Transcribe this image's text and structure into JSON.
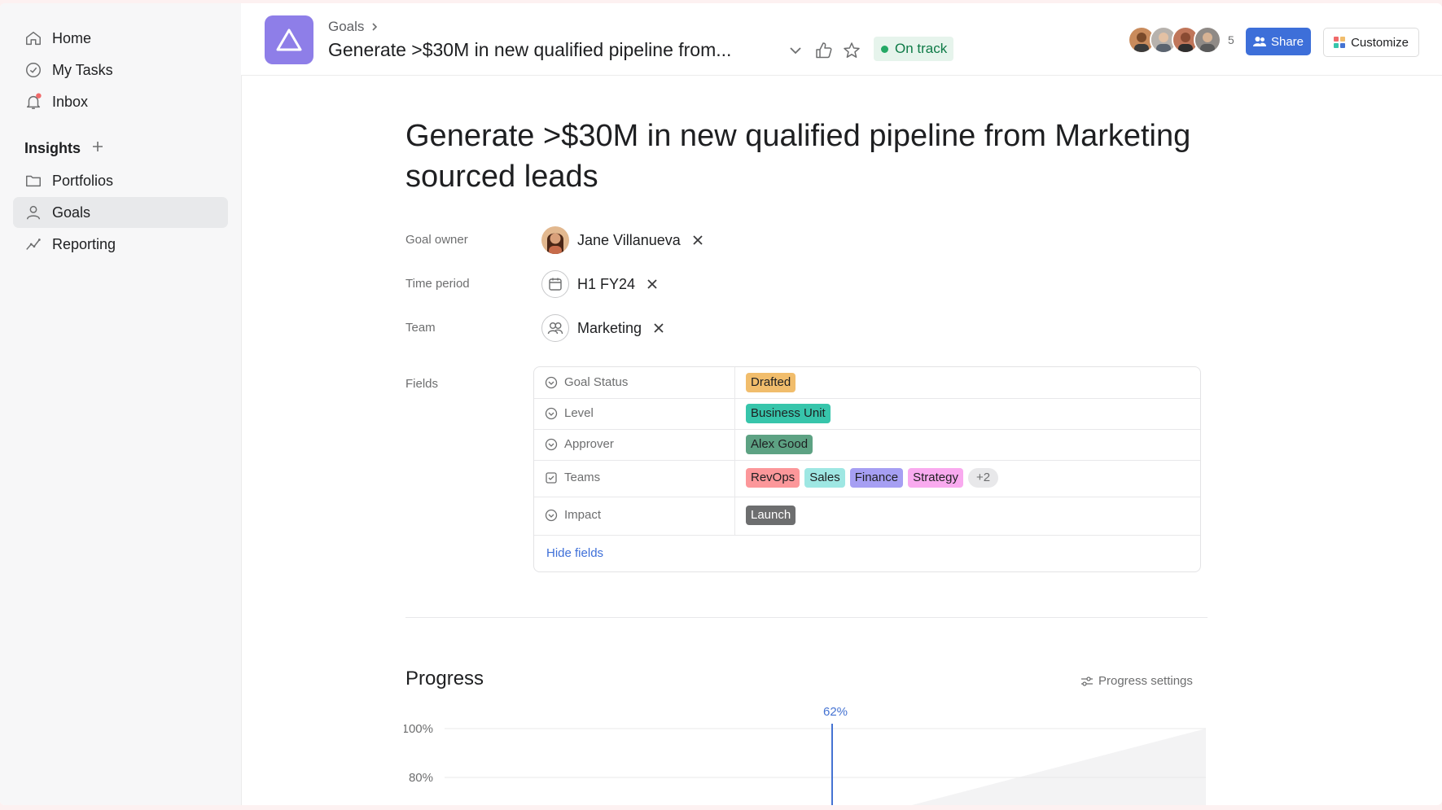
{
  "sidebar": {
    "items": [
      {
        "label": "Home",
        "icon": "home-icon"
      },
      {
        "label": "My Tasks",
        "icon": "check-circle-icon"
      },
      {
        "label": "Inbox",
        "icon": "bell-icon"
      }
    ],
    "section": {
      "title": "Insights",
      "add_icon": "plus-icon"
    },
    "section_items": [
      {
        "label": "Portfolios",
        "icon": "folder-icon"
      },
      {
        "label": "Goals",
        "icon": "person-icon",
        "active": true
      },
      {
        "label": "Reporting",
        "icon": "trend-line-icon"
      }
    ]
  },
  "header": {
    "breadcrumb": "Goals",
    "title": "Generate >$30M in new qualified pipeline from...",
    "status": "On track",
    "avatar_count": "5",
    "share_label": "Share",
    "customize_label": "Customize"
  },
  "goal": {
    "title": "Generate >$30M in new qualified pipeline from Marketing sourced leads",
    "owner": {
      "label": "Goal owner",
      "value": "Jane Villanueva"
    },
    "time_period": {
      "label": "Time period",
      "value": "H1 FY24"
    },
    "team": {
      "label": "Team",
      "value": "Marketing"
    }
  },
  "fields": {
    "label": "Fields",
    "rows": [
      {
        "name": "Goal Status",
        "chips": [
          {
            "text": "Drafted",
            "color": "#f1bd6c"
          }
        ]
      },
      {
        "name": "Level",
        "chips": [
          {
            "text": "Business Unit",
            "color": "#37c5ab"
          }
        ]
      },
      {
        "name": "Approver",
        "chips": [
          {
            "text": "Alex Good",
            "color": "#5da283"
          }
        ]
      },
      {
        "name": "Teams",
        "chips": [
          {
            "text": "RevOps",
            "color": "#fc979a"
          },
          {
            "text": "Sales",
            "color": "#9ee7e3"
          },
          {
            "text": "Finance",
            "color": "#a69ff3"
          },
          {
            "text": "Strategy",
            "color": "#f9aaef"
          },
          {
            "text": "+2",
            "color": "#e8e8ea"
          }
        ]
      },
      {
        "name": "Impact",
        "chips": [
          {
            "text": "Launch",
            "color": "#6d6e6f"
          }
        ]
      }
    ],
    "hide_label": "Hide fields"
  },
  "progress": {
    "title": "Progress",
    "settings_label": "Progress settings"
  },
  "chart_data": {
    "type": "line",
    "y_ticks": [
      "100%",
      "80%"
    ],
    "marker_label": "62%",
    "ylim": [
      80,
      100
    ]
  }
}
